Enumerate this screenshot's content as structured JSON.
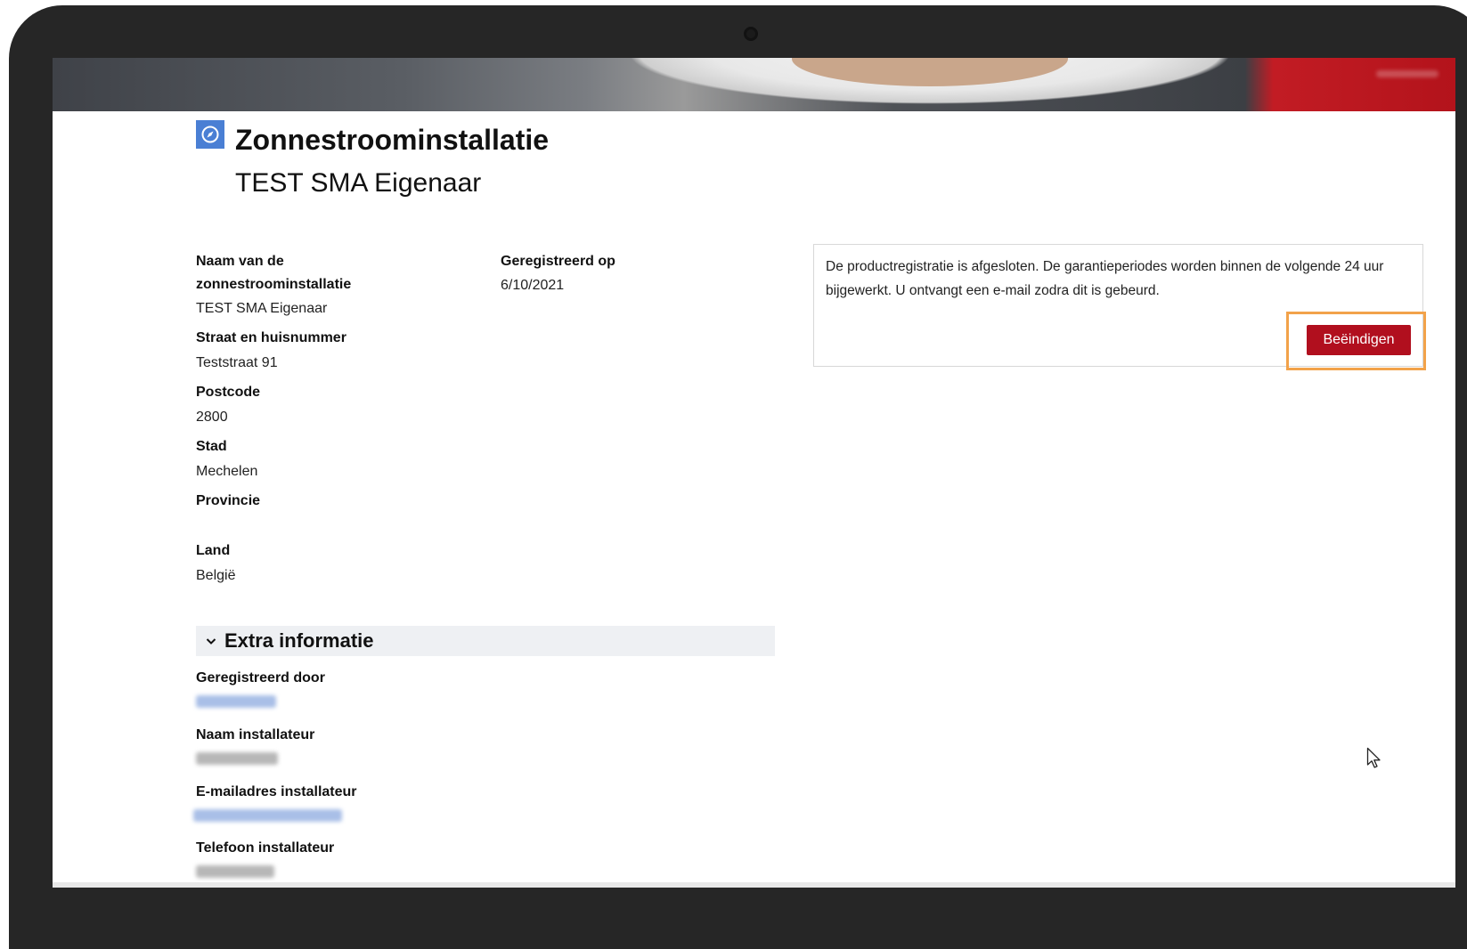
{
  "page": {
    "title": "Zonnestroominstallatie",
    "subtitle": "TEST SMA Eigenaar"
  },
  "details": {
    "name_label_line1": "Naam van de",
    "name_label_line2": "zonnestroominstallatie",
    "name_value": "TEST SMA Eigenaar",
    "registered_on_label": "Geregistreerd op",
    "registered_on_value": "6/10/2021",
    "street_label": "Straat en huisnummer",
    "street_value": "Teststraat 91",
    "postcode_label": "Postcode",
    "postcode_value": "2800",
    "city_label": "Stad",
    "city_value": "Mechelen",
    "province_label": "Provincie",
    "province_value": "",
    "country_label": "Land",
    "country_value": "België"
  },
  "extra": {
    "title": "Extra informatie",
    "registered_by_label": "Geregistreerd door",
    "installer_name_label": "Naam installateur",
    "installer_email_label": "E-mailadres installateur",
    "installer_phone_label": "Telefoon installateur"
  },
  "notice": {
    "text": "De productregistratie is afgesloten. De garantieperiodes worden binnen de volgende 24 uur bijgewerkt. U ontvangt een e-mail zodra dit is gebeurd.",
    "button_label": "Beëindigen"
  },
  "colors": {
    "button": "#b10f1e",
    "highlight": "#f2a24a",
    "icon": "#4a7fd4",
    "device_frame": "#262626"
  },
  "icons": {
    "title_icon": "compass-icon",
    "section_toggle": "chevron-down-icon",
    "pointer": "mouse-pointer-icon"
  }
}
